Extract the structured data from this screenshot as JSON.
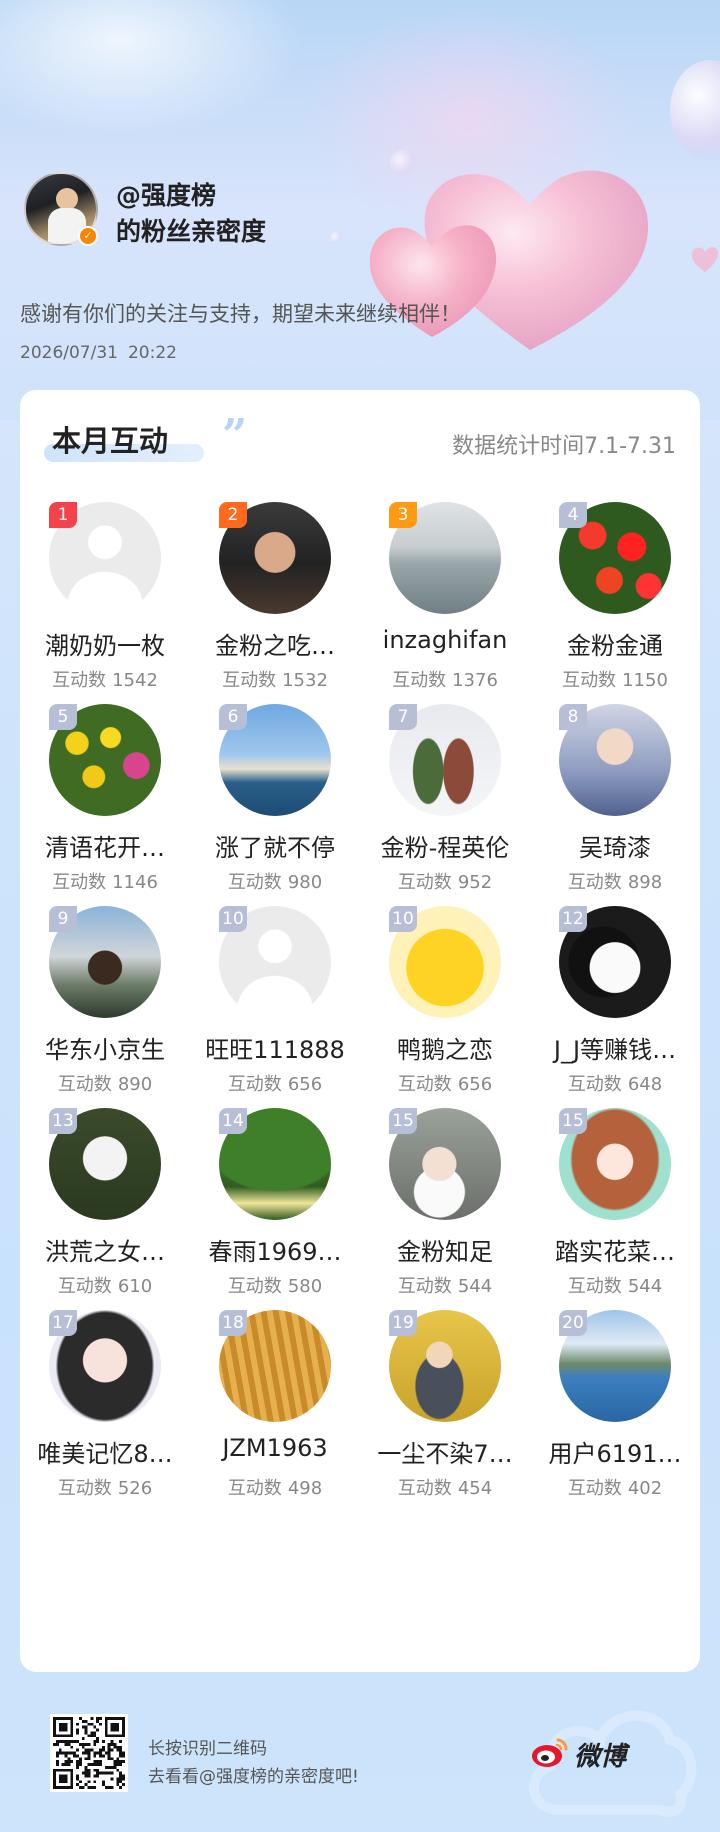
{
  "header": {
    "owner_name": "@强度榜",
    "subtitle": "的粉丝亲密度",
    "thanks_text": "感谢有你们的关注与支持，期望未来继续相伴！",
    "date": "2026/07/31",
    "time": "20:22"
  },
  "card": {
    "title": "本月互动",
    "stat_range": "数据统计时间7.1-7.31",
    "count_label": "互动数"
  },
  "fans": [
    {
      "rank": "1",
      "name": "潮奶奶一枚",
      "count": "1542",
      "avatar": "default"
    },
    {
      "rank": "2",
      "name": "金粉之吃…",
      "count": "1532",
      "avatar": "sunglasses-man"
    },
    {
      "rank": "3",
      "name": "inzaghifan",
      "count": "1376",
      "avatar": "misty-lake"
    },
    {
      "rank": "4",
      "name": "金粉金通",
      "count": "1150",
      "avatar": "red-flowers"
    },
    {
      "rank": "5",
      "name": "清语花开…",
      "count": "1146",
      "avatar": "tulips"
    },
    {
      "rank": "6",
      "name": "涨了就不停",
      "count": "980",
      "avatar": "opera-house"
    },
    {
      "rank": "7",
      "name": "金粉-程英伦",
      "count": "952",
      "avatar": "couple-snow"
    },
    {
      "rank": "8",
      "name": "吴琦漆",
      "count": "898",
      "avatar": "young-man"
    },
    {
      "rank": "9",
      "name": "华东小京生",
      "count": "890",
      "avatar": "man-sunset"
    },
    {
      "rank": "10",
      "name": "旺旺111888",
      "count": "656",
      "avatar": "default"
    },
    {
      "rank": "10",
      "name": "鸭鹅之恋",
      "count": "656",
      "avatar": "cartoon-tiger"
    },
    {
      "rank": "12",
      "name": "J_J等赚钱…",
      "count": "648",
      "avatar": "panda-toy"
    },
    {
      "rank": "13",
      "name": "洪荒之女…",
      "count": "610",
      "avatar": "kitten"
    },
    {
      "rank": "14",
      "name": "春雨1969…",
      "count": "580",
      "avatar": "green-tree"
    },
    {
      "rank": "15",
      "name": "金粉知足",
      "count": "544",
      "avatar": "child"
    },
    {
      "rank": "15",
      "name": "踏实花菜…",
      "count": "544",
      "avatar": "anime-girl"
    },
    {
      "rank": "17",
      "name": "唯美记忆8…",
      "count": "526",
      "avatar": "woman-portrait"
    },
    {
      "rank": "18",
      "name": "JZM1963",
      "count": "498",
      "avatar": "wheat"
    },
    {
      "rank": "19",
      "name": "一尘不染7…",
      "count": "454",
      "avatar": "little-monk"
    },
    {
      "rank": "20",
      "name": "用户6191…",
      "count": "402",
      "avatar": "mountain-lake"
    }
  ],
  "footer": {
    "line1": "长按识别二维码",
    "line2": "去看看@强度榜的亲密度吧!",
    "brand": "微博"
  },
  "colors": {
    "rank1": "#f4414a",
    "rank2": "#ff6a1f",
    "rank3": "#ff9a14",
    "rank_other": "#b7bfd6",
    "verify_badge": "#ff8200"
  }
}
